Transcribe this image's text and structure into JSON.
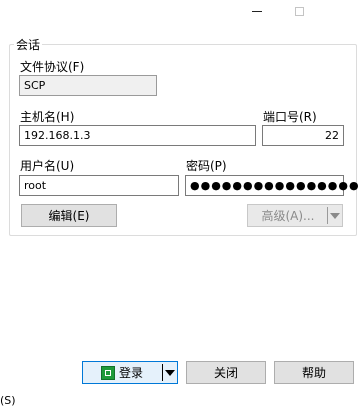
{
  "window": {
    "minimize_glyph": "",
    "maximize_glyph": ""
  },
  "session": {
    "group_label": "会话",
    "protocol_label": "文件协议(F)",
    "protocol_value": "SCP",
    "host_label": "主机名(H)",
    "host_value": "192.168.1.3",
    "port_label": "端口号(R)",
    "port_value": "22",
    "user_label": "用户名(U)",
    "user_value": "root",
    "password_label": "密码(P)",
    "password_value": "●●●●●●●●●●●●●●●●",
    "edit_button": "编辑(E)",
    "advanced_button": "高级(A)..."
  },
  "footer": {
    "login_button": "登录",
    "close_button": "关闭",
    "help_button": "帮助",
    "status_text": "(S)"
  },
  "icons": {
    "login": "login-icon",
    "dropdown": "chevron-down-icon"
  }
}
